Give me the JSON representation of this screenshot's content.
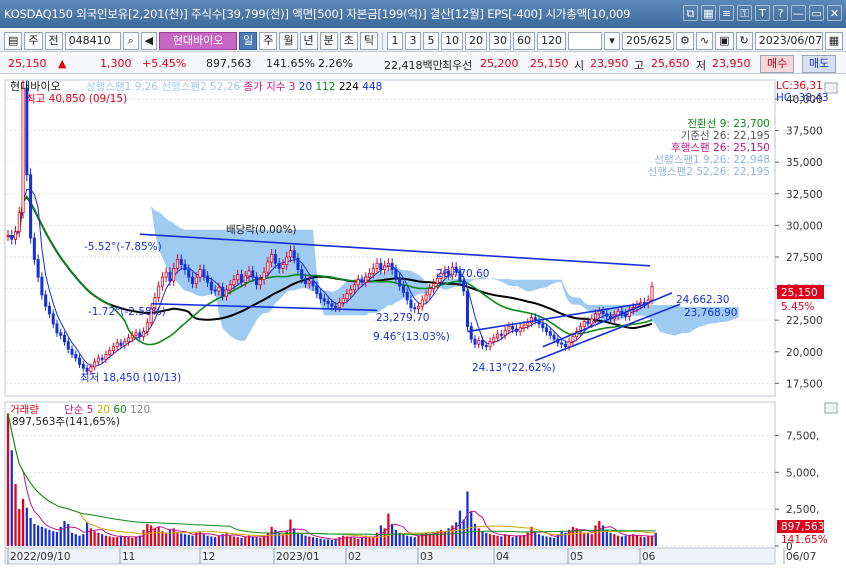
{
  "titlebar": {
    "text": "KOSDAQ150 외국인보유[2,201(천)] 주식수[39,799(천)] 액면[500] 자본금[199(억)] 결산[12월] EPS[-400] 시가총액[10,009",
    "icons": [
      "window-icon",
      "grid-icon",
      "list-icon",
      "lock-icon",
      "text-icon",
      "help-icon",
      "minimize-icon",
      "restore-icon",
      "close-icon"
    ],
    "icon_glyphs": [
      "⧉",
      "▦",
      "≡",
      "⚿",
      "T",
      "?",
      "—",
      "▭",
      "✕"
    ]
  },
  "toolbar": {
    "left_buttons": [
      "▤",
      "주",
      "전"
    ],
    "code": "048410",
    "name": "현대바이오",
    "period_tabs": [
      "일",
      "주",
      "월",
      "년",
      "분",
      "초",
      "틱"
    ],
    "active_period": "일",
    "minute_options": [
      "1",
      "3",
      "5",
      "10",
      "20",
      "30",
      "60",
      "120"
    ],
    "range": "205/625",
    "date": "2023/06/07"
  },
  "quote": {
    "price": "25,150",
    "change": "1,300",
    "change_pct": "+5.45%",
    "volume": "897,563",
    "volume_pct": "141.65%",
    "turnover_pct": "2.26%",
    "amount": "22,418백만",
    "best_ask_label": "최우선",
    "best_ask": "25,200",
    "best_bid": "25,150",
    "open_label": "시",
    "open": "23,950",
    "high_label": "고",
    "high": "25,650",
    "low_label": "저",
    "low": "23,950",
    "sell_label": "매수",
    "buy_label": "매도"
  },
  "chart_data": [
    {
      "type": "line",
      "title": "현대바이오",
      "legend": [
        {
          "name": "선행스팬1 9,26",
          "color": "#9ec7ef"
        },
        {
          "name": "선행스팬2 52,26",
          "color": "#9ec7ef"
        },
        {
          "name": "종가 지수 3",
          "color": "#d8118a"
        },
        {
          "name": "20",
          "color": "#1530d8"
        },
        {
          "name": "112",
          "color": "#0a8a1a"
        },
        {
          "name": "224",
          "color": "#000000"
        },
        {
          "name": "448",
          "color": "#1530d8"
        }
      ],
      "ichimoku_values": [
        {
          "name": "전환선 9: 23,700",
          "color": "#0a8a1a"
        },
        {
          "name": "기준선 26: 22,195",
          "color": "#555555"
        },
        {
          "name": "후행스팬 26: 25,150",
          "color": "#c0168a"
        },
        {
          "name": "선행스팬1 9,26: 22,948",
          "color": "#8fb8e6"
        },
        {
          "name": "선행스팬2 52,26: 22,195",
          "color": "#8fb8e6"
        }
      ],
      "y_ticks": [
        17500,
        20000,
        22500,
        25000,
        27500,
        30000,
        32500,
        35000,
        37500,
        40000
      ],
      "y_tick_labels": [
        "17,500",
        "20,000",
        "22,500",
        "25,000",
        "27,500",
        "30,000",
        "32,500",
        "35,000",
        "37,500",
        "40,000"
      ],
      "ylim": [
        16500,
        41500
      ],
      "x_labels": [
        "2022/09/10",
        "11",
        "12",
        "2023/01",
        "02",
        "03",
        "04",
        "05",
        "06",
        "06/07"
      ],
      "lc": "LC:36,31",
      "hc": "HC:-38,43",
      "price_box": "25,150",
      "price_box_pct": "5.45%",
      "high_annot": "최고 40,850 (09/15)",
      "low_annot": "최저 18,450 (10/13)",
      "dividend_annot": "배당락(0.00%)",
      "trend_labels": [
        "-5.52°(-7.85%)",
        "-1.72°(-2.58%)",
        "23,279.70",
        "26,770.60",
        "9.46°(13.03%)",
        "24.13°(22.62%)",
        "24,662.30",
        "23,768.90"
      ],
      "close": [
        29200,
        28900,
        29500,
        31000,
        40850,
        34000,
        29000,
        27300,
        25900,
        24500,
        23600,
        23000,
        22200,
        21500,
        21300,
        20800,
        20200,
        19800,
        19500,
        19000,
        18700,
        18450,
        18800,
        19200,
        19500,
        19400,
        19800,
        20100,
        20400,
        20700,
        20500,
        20800,
        21100,
        21300,
        21500,
        21200,
        21600,
        22300,
        23400,
        24300,
        25200,
        25900,
        26300,
        25600,
        26600,
        27300,
        26900,
        26500,
        25900,
        25400,
        25900,
        26500,
        26000,
        25500,
        24900,
        24800,
        25100,
        24400,
        24900,
        25300,
        25700,
        26100,
        25500,
        26000,
        26400,
        25900,
        25300,
        25700,
        26300,
        27100,
        27700,
        27000,
        26600,
        26900,
        27500,
        28000,
        27400,
        26500,
        25800,
        25400,
        25600,
        25200,
        24600,
        24200,
        24000,
        23800,
        23600,
        23500,
        23900,
        24200,
        24600,
        24900,
        25300,
        25700,
        25500,
        25900,
        26200,
        26600,
        27000,
        26500,
        26800,
        27000,
        26500,
        25800,
        25200,
        24700,
        24100,
        23500,
        23400,
        23600,
        24100,
        24500,
        25000,
        25400,
        25800,
        26200,
        26400,
        26100,
        26700,
        26400,
        25600,
        24800,
        22000,
        21000,
        20600,
        20900,
        20500,
        20400,
        20800,
        21100,
        21400,
        21300,
        21700,
        22000,
        21800,
        21600,
        21900,
        22100,
        22300,
        22700,
        22500,
        22200,
        21900,
        21600,
        21300,
        21000,
        20700,
        20600,
        20400,
        20800,
        21200,
        21600,
        22000,
        22400,
        22200,
        22600,
        23000,
        23200,
        23000,
        22800,
        22600,
        22900,
        23200,
        23000,
        22800,
        23300,
        23500,
        23700,
        23900,
        23800,
        24100,
        25150
      ]
    },
    {
      "type": "bar",
      "title": "거래량",
      "legend": [
        {
          "name": "거래량",
          "color": "#e0001b"
        },
        {
          "name": "단순 5",
          "color": "#c0168a"
        },
        {
          "name": "20",
          "color": "#c9a800"
        },
        {
          "name": "60",
          "color": "#0a8a1a"
        },
        {
          "name": "120",
          "color": "#888888"
        }
      ],
      "current_label": "897,563주(141,65%)",
      "y_ticks": [
        0,
        2500,
        5000,
        7500
      ],
      "y_tick_labels": [
        "0",
        "2,500,",
        "5,000,",
        "7,500,"
      ],
      "ylim": [
        0,
        9500
      ],
      "y_unit": "thousand shares",
      "volume_box": "897,563",
      "volume_pct": "141.65%",
      "values": [
        9000,
        6500,
        4200,
        2500,
        3200,
        2600,
        1900,
        1500,
        1400,
        1300,
        1200,
        1100,
        1000,
        950,
        1300,
        1700,
        1500,
        900,
        800,
        700,
        800,
        1600,
        1200,
        1000,
        900,
        800,
        700,
        650,
        600,
        600,
        700,
        650,
        600,
        550,
        600,
        700,
        1100,
        1500,
        1400,
        1200,
        1300,
        1000,
        900,
        1100,
        1200,
        950,
        850,
        800,
        750,
        700,
        900,
        1000,
        800,
        700,
        650,
        600,
        700,
        800,
        900,
        700,
        650,
        600,
        550,
        600,
        700,
        650,
        600,
        550,
        700,
        900,
        1300,
        1100,
        900,
        800,
        1000,
        1800,
        1200,
        900,
        800,
        700,
        650,
        600,
        550,
        500,
        450,
        450,
        400,
        500,
        600,
        700,
        650,
        600,
        550,
        500,
        600,
        700,
        650,
        600,
        900,
        1400,
        1200,
        2200,
        1500,
        1100,
        900,
        800,
        700,
        650,
        600,
        700,
        800,
        900,
        850,
        900,
        1000,
        1100,
        950,
        1200,
        1400,
        1600,
        2400,
        1800,
        3700,
        2300,
        1500,
        1200,
        1000,
        900,
        800,
        750,
        700,
        650,
        800,
        700,
        600,
        650,
        700,
        750,
        900,
        1300,
        1000,
        800,
        700,
        650,
        600,
        550,
        800,
        1000,
        900,
        1100,
        1300,
        1200,
        1000,
        900,
        850,
        800,
        1400,
        1700,
        1400,
        1100,
        900,
        800,
        700,
        650,
        700,
        750,
        800,
        700,
        650,
        600,
        650,
        700,
        898
      ]
    }
  ]
}
